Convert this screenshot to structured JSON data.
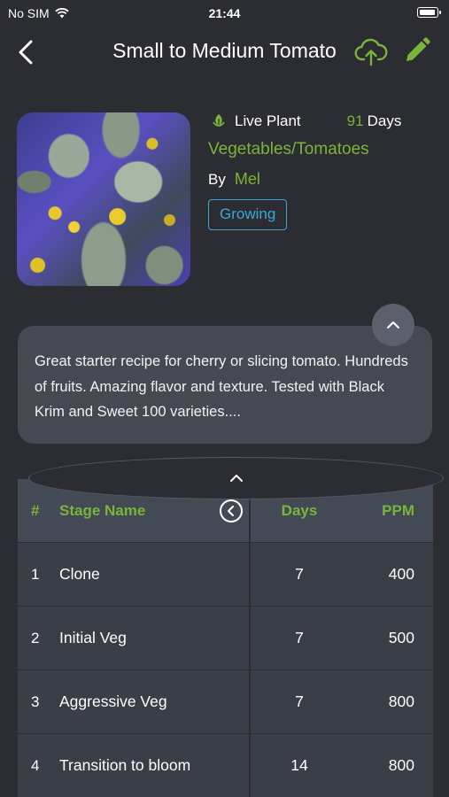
{
  "status_bar": {
    "carrier": "No SIM",
    "time": "21:44"
  },
  "nav": {
    "title": "Small to Medium Tomato",
    "back_icon": "chevron-left-icon",
    "upload_icon": "cloud-upload-icon",
    "edit_icon": "pencil-icon"
  },
  "recipe": {
    "plant_type": "Live Plant",
    "days_value": "91",
    "days_label": "Days",
    "category": "Vegetables/Tomatoes",
    "by_label": "By",
    "author": "Mel",
    "status": "Growing",
    "description": "Great starter recipe for cherry or slicing tomato. Hundreds of fruits. Amazing flavor and texture. Tested with Black Krim and Sweet 100 varieties...."
  },
  "table": {
    "headers": {
      "num": "#",
      "stage": "Stage Name",
      "days": "Days",
      "ppm": "PPM"
    },
    "rows": [
      {
        "num": "1",
        "stage": "Clone",
        "days": "7",
        "ppm": "400"
      },
      {
        "num": "2",
        "stage": "Initial Veg",
        "days": "7",
        "ppm": "500"
      },
      {
        "num": "3",
        "stage": "Aggressive Veg",
        "days": "7",
        "ppm": "800"
      },
      {
        "num": "4",
        "stage": "Transition to bloom",
        "days": "14",
        "ppm": "800"
      }
    ]
  },
  "colors": {
    "accent_green": "#7ab43a",
    "badge_blue": "#3aa8d8",
    "background": "#2b2d32"
  }
}
